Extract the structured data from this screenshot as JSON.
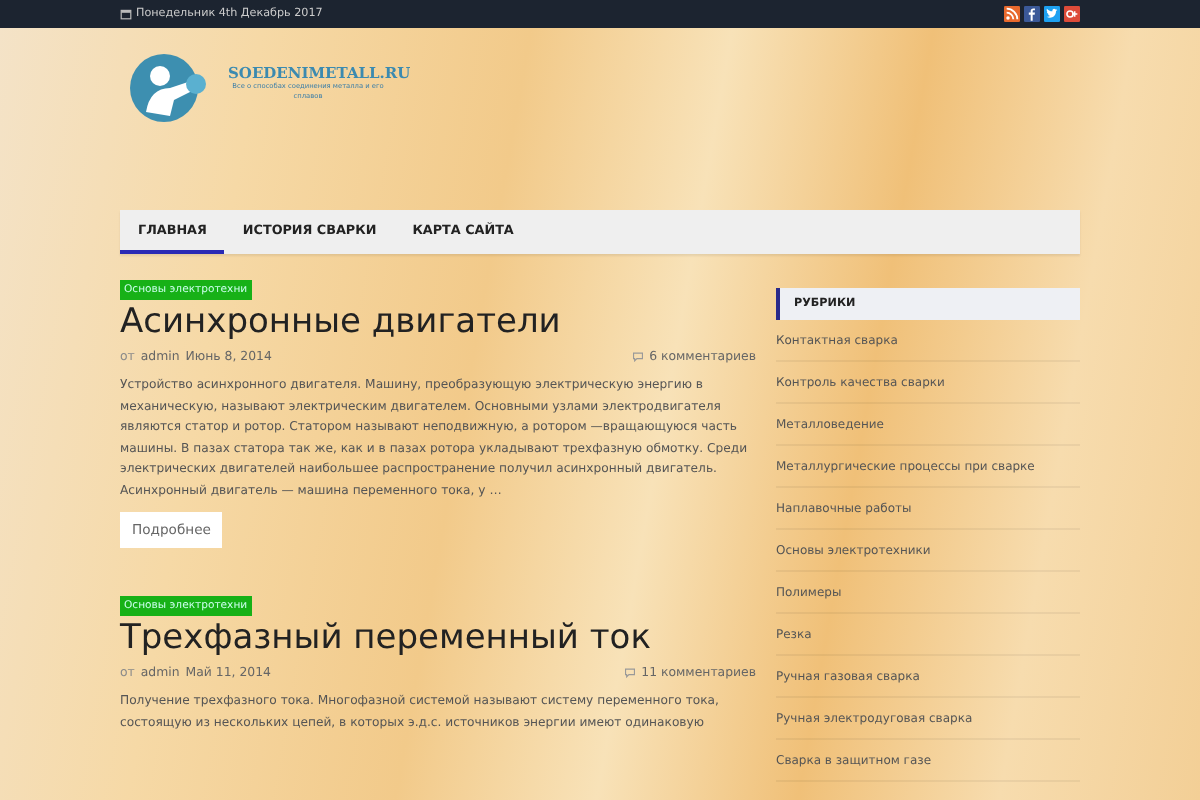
{
  "top_bar": {
    "date": "Понедельник 4th Декабрь 2017",
    "social": [
      {
        "kind": "rss"
      },
      {
        "kind": "facebook"
      },
      {
        "kind": "twitter"
      },
      {
        "kind": "googleplus"
      }
    ]
  },
  "header": {
    "site_title": "SOEDENIMETALL.RU",
    "tagline": "Все о способах соединения металла и его сплавов"
  },
  "nav": [
    {
      "label": "ГЛАВНАЯ",
      "selected": true
    },
    {
      "label": "ИСТОРИЯ СВАРКИ",
      "selected": false
    },
    {
      "label": "КАРТА САЙТА",
      "selected": false
    }
  ],
  "posts": [
    {
      "category": "Основы электротехни",
      "title": "Асинхронные двигатели",
      "by": "от",
      "author": "admin",
      "date": "Июнь 8, 2014",
      "comments": "6 комментариев",
      "excerpt": "Устройство асинхронного двигателя. Машину, преобразующую электрическую энергию в механическую, называют электрическим двигателем. Основными узлами электродвигателя являются статор и ротор. Статором называют неподвижную, а ротором —вращающуюся часть машины. В пазах статора так же, как и в пазах ротора укладывают трехфазную обмотку. Среди электрических двигателей наибольшее распространение получил асинхронный двигатель. Асинхронный двигатель — машина переменного тока, у …",
      "more": "Подробнее"
    },
    {
      "category": "Основы электротехни",
      "title": "Трехфазный переменный ток",
      "by": "от",
      "author": "admin",
      "date": "Май 11, 2014",
      "comments": "11 комментариев",
      "excerpt": "Получение трехфазного тока. Многофазной системой называют систему переменного тока, состоящую из нескольких цепей, в которых э.д.с. источников энергии имеют одинаковую"
    }
  ],
  "sidebar": {
    "title": "РУБРИКИ",
    "items": [
      "Контактная сварка",
      "Контроль качества сварки",
      "Металловедение",
      "Металлургические процессы при сварке",
      "Наплавочные работы",
      "Основы электротехники",
      "Полимеры",
      "Резка",
      "Ручная газовая сварка",
      "Ручная электродуговая сварка",
      "Сварка в защитном газе"
    ]
  }
}
